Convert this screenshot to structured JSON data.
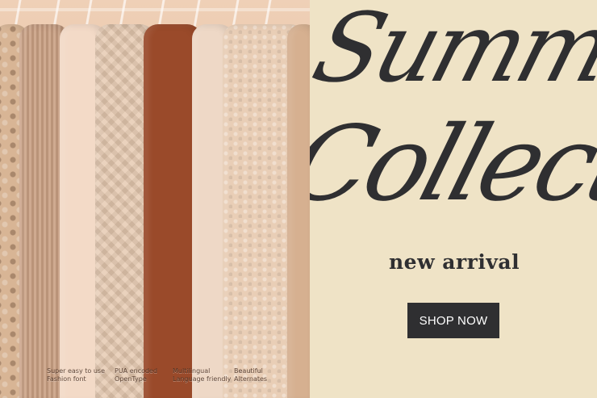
{
  "banner": {
    "title_line1": "Summer",
    "title_line2": "Collection",
    "subtitle": "new arrival",
    "cta_label": "SHOP NOW"
  },
  "features": [
    {
      "label": "Super easy to use\nFashion font"
    },
    {
      "label": "PUA encoded\nOpenType"
    },
    {
      "label": "Multilingual\nLanguage friendly"
    },
    {
      "label": "Beautiful\nAlternates"
    }
  ],
  "colors": {
    "background": "#efe3c6",
    "text": "#2f2f31",
    "button_bg": "#2f2f31",
    "button_text": "#ffffff"
  }
}
